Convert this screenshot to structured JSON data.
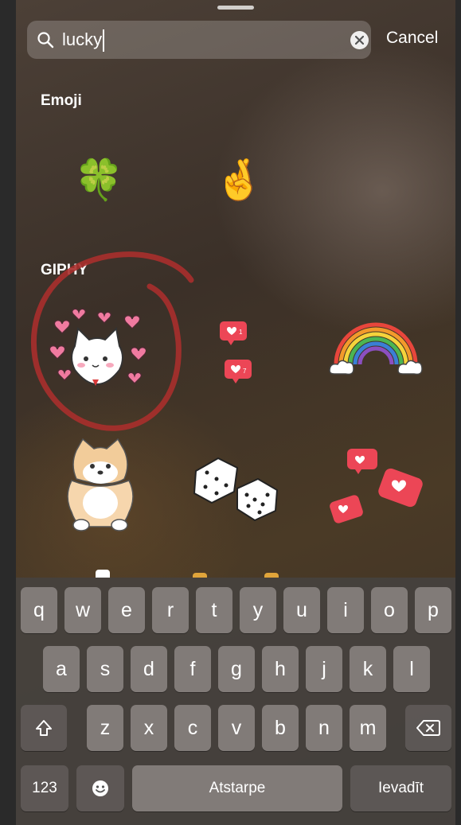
{
  "search": {
    "query": "lucky",
    "cancel_label": "Cancel"
  },
  "sections": {
    "emoji_label": "Emoji",
    "giphy_label": "GIPHY"
  },
  "emoji_results": [
    "🍀",
    "🤞"
  ],
  "giphy_stickers": [
    {
      "name": "cat-hearts-sticker"
    },
    {
      "name": "like-notification-sticker"
    },
    {
      "name": "rainbow-sticker"
    },
    {
      "name": "puppy-sticker"
    },
    {
      "name": "dice-sticker"
    },
    {
      "name": "likes-burst-sticker"
    }
  ],
  "like_badge_count": "1",
  "like_badge_count_large": "7",
  "annotation_color": "#b0302c",
  "keyboard": {
    "row1": [
      "q",
      "w",
      "e",
      "r",
      "t",
      "y",
      "u",
      "i",
      "o",
      "p"
    ],
    "row2": [
      "a",
      "s",
      "d",
      "f",
      "g",
      "h",
      "j",
      "k",
      "l"
    ],
    "row3": [
      "z",
      "x",
      "c",
      "v",
      "b",
      "n",
      "m"
    ],
    "numbers_key": "123",
    "space_key": "Atstarpe",
    "return_key": "Ievadīt",
    "shift_icon": "shift-icon",
    "emoji_icon": "emoji-icon",
    "delete_icon": "backspace-icon"
  }
}
